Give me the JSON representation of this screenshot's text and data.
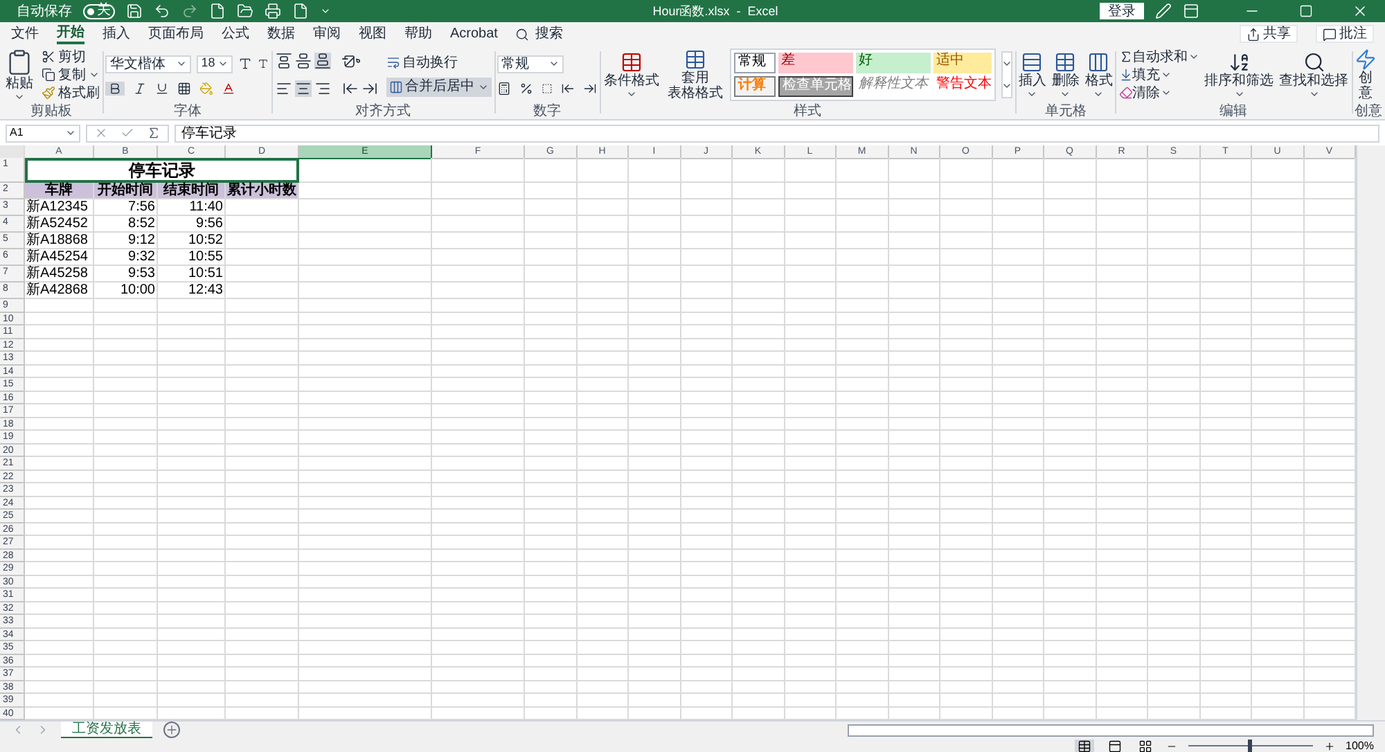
{
  "title_bar": {
    "autosave_label": "自动保存",
    "autosave_state": "关",
    "autosave_on": false,
    "title": "Hour函数.xlsx  -  Excel",
    "sign_in": "登录"
  },
  "menu_tabs": [
    {
      "label": "文件",
      "selected": false
    },
    {
      "label": "开始",
      "selected": true
    },
    {
      "label": "插入",
      "selected": false
    },
    {
      "label": "页面布局",
      "selected": false
    },
    {
      "label": "公式",
      "selected": false
    },
    {
      "label": "数据",
      "selected": false
    },
    {
      "label": "审阅",
      "selected": false
    },
    {
      "label": "视图",
      "selected": false
    },
    {
      "label": "帮助",
      "selected": false
    },
    {
      "label": "Acrobat",
      "selected": false
    }
  ],
  "search": "搜索",
  "share": "共享",
  "comments": "批注",
  "clipboard": {
    "paste": "粘贴",
    "cut": "剪切",
    "copy": "复制",
    "format_painter": "格式刷",
    "label": "剪贴板"
  },
  "font": {
    "name": "华文楷体",
    "size": "18",
    "label": "字体"
  },
  "alignment": {
    "wrap": "自动换行",
    "merge": "合并后居中",
    "label": "对齐方式"
  },
  "number": {
    "format": "常规",
    "label": "数字"
  },
  "styles": {
    "conditional": "条件格式",
    "table_format": [
      "套用",
      "表格格式"
    ],
    "label": "样式",
    "gallery": [
      {
        "label": "常规",
        "kind": "normal"
      },
      {
        "label": "差",
        "kind": "bad"
      },
      {
        "label": "好",
        "kind": "good"
      },
      {
        "label": "适中",
        "kind": "neutral"
      },
      {
        "label": "计算",
        "kind": "calc"
      },
      {
        "label": "检查单元格",
        "kind": "check"
      },
      {
        "label": "解释性文本",
        "kind": "explanatory"
      },
      {
        "label": "警告文本",
        "kind": "warning"
      }
    ]
  },
  "cells": {
    "buttons": [
      "插入",
      "删除",
      "格式"
    ],
    "label": "单元格"
  },
  "editing": {
    "autosum": "自动求和",
    "fill": "填充",
    "clear": "清除",
    "sort": "排序和筛选",
    "find": "查找和选择",
    "label": "编辑"
  },
  "create": {
    "button": "创意",
    "label": "创意"
  },
  "formula_bar": {
    "name_box": "A1",
    "formula": "停车记录"
  },
  "columns": [
    {
      "label": "A",
      "selected": false
    },
    {
      "label": "B",
      "selected": false
    },
    {
      "label": "C",
      "selected": false
    },
    {
      "label": "D",
      "selected": false
    },
    {
      "label": "E",
      "selected": true
    },
    {
      "label": "F",
      "selected": false
    },
    {
      "label": "G",
      "selected": false
    },
    {
      "label": "H",
      "selected": false
    },
    {
      "label": "I",
      "selected": false
    },
    {
      "label": "J",
      "selected": false
    },
    {
      "label": "K",
      "selected": false
    },
    {
      "label": "L",
      "selected": false
    },
    {
      "label": "M",
      "selected": false
    },
    {
      "label": "N",
      "selected": false
    },
    {
      "label": "O",
      "selected": false
    },
    {
      "label": "P",
      "selected": false
    },
    {
      "label": "Q",
      "selected": false
    },
    {
      "label": "R",
      "selected": false
    },
    {
      "label": "S",
      "selected": false
    },
    {
      "label": "T",
      "selected": false
    },
    {
      "label": "U",
      "selected": false
    },
    {
      "label": "V",
      "selected": false
    }
  ],
  "row_numbers": [
    "1",
    "2",
    "3",
    "4",
    "5",
    "6",
    "7",
    "8",
    "9",
    "10",
    "11",
    "12",
    "13",
    "14",
    "15",
    "16",
    "17",
    "18",
    "19",
    "20",
    "21",
    "22",
    "23",
    "24",
    "25",
    "26",
    "27",
    "28",
    "29",
    "30",
    "31",
    "32",
    "33",
    "34",
    "35",
    "36",
    "37",
    "38",
    "39",
    "40"
  ],
  "sheet_title": "停车记录",
  "table_headers": [
    "车牌",
    "开始时间",
    "结束时间",
    "累计小时数"
  ],
  "table_rows": [
    [
      "新A12345",
      "7:56",
      "11:40"
    ],
    [
      "新A52452",
      "8:52",
      "9:56"
    ],
    [
      "新A18868",
      "9:12",
      "10:52"
    ],
    [
      "新A45254",
      "9:32",
      "10:55"
    ],
    [
      "新A45258",
      "9:53",
      "10:51"
    ],
    [
      "新A42868",
      "10:00",
      "12:43"
    ]
  ],
  "sheet_tabs": [
    {
      "label": "工资发放表",
      "selected": true
    }
  ],
  "status_bar": {
    "views": [
      {
        "kind": "normal",
        "selected": true
      },
      {
        "kind": "layout",
        "selected": false
      },
      {
        "kind": "pagebreak",
        "selected": false
      }
    ],
    "zoom": {
      "level": 0.5,
      "reading": "100%"
    }
  }
}
